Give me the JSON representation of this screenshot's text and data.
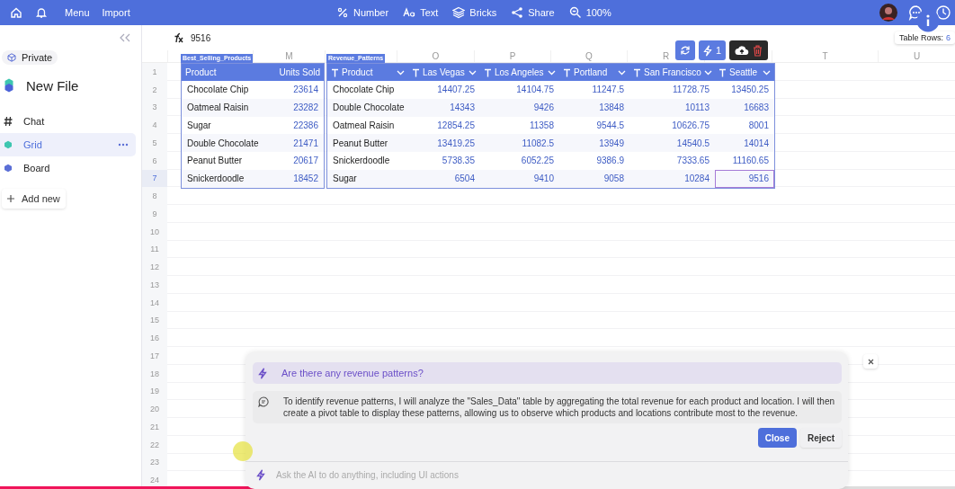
{
  "topbar": {
    "menu_items": [
      "Menu",
      "Import"
    ],
    "tools": [
      {
        "kind": "percent",
        "label": "Number"
      },
      {
        "kind": "text",
        "label": "Text"
      },
      {
        "kind": "layers",
        "label": "Bricks"
      },
      {
        "kind": "share",
        "label": "Share"
      },
      {
        "kind": "zoom",
        "label": "100%"
      }
    ]
  },
  "sidebar": {
    "workspace": "Private",
    "file_name": "New File",
    "items": [
      {
        "kind": "chat",
        "label": "Chat",
        "selected": false
      },
      {
        "kind": "grid",
        "label": "Grid",
        "selected": true
      },
      {
        "kind": "board",
        "label": "Board",
        "selected": false
      }
    ],
    "add_new": "Add new"
  },
  "formula": "9516",
  "table_rows_info": {
    "label": "Table Rows:",
    "value": "6"
  },
  "column_letters": [
    "M",
    "O",
    "P",
    "Q",
    "R",
    "T",
    "U"
  ],
  "row_numbers": [
    {
      "label": "1",
      "selected": false
    },
    {
      "label": "2",
      "selected": false
    },
    {
      "label": "3",
      "selected": false
    },
    {
      "label": "4",
      "selected": false
    },
    {
      "label": "5",
      "selected": false
    },
    {
      "label": "6",
      "selected": false
    },
    {
      "label": "7",
      "selected": true
    },
    {
      "label": "8",
      "selected": false
    },
    {
      "label": "9",
      "selected": false
    },
    {
      "label": "10",
      "selected": false
    },
    {
      "label": "11",
      "selected": false
    },
    {
      "label": "12",
      "selected": false
    },
    {
      "label": "13",
      "selected": false
    },
    {
      "label": "14",
      "selected": false
    },
    {
      "label": "15",
      "selected": false
    },
    {
      "label": "16",
      "selected": false
    },
    {
      "label": "17",
      "selected": false
    },
    {
      "label": "18",
      "selected": false
    },
    {
      "label": "19",
      "selected": false
    },
    {
      "label": "20",
      "selected": false
    },
    {
      "label": "21",
      "selected": false
    },
    {
      "label": "22",
      "selected": false
    },
    {
      "label": "23",
      "selected": false
    },
    {
      "label": "24",
      "selected": false
    }
  ],
  "table_toolbar": {
    "count": "1"
  },
  "tables": [
    {
      "name": "Best_Selling_Products",
      "kind": "plain",
      "columns": [
        {
          "label": "Product",
          "kind": "text"
        },
        {
          "label": "Units Sold",
          "kind": "number"
        }
      ],
      "rows": [
        {
          "cells": [
            {
              "text": "Chocolate Chip",
              "selected": false
            },
            {
              "text": "23614",
              "selected": false
            }
          ]
        },
        {
          "cells": [
            {
              "text": "Oatmeal Raisin",
              "selected": false
            },
            {
              "text": "23282",
              "selected": false
            }
          ]
        },
        {
          "cells": [
            {
              "text": "Sugar",
              "selected": false
            },
            {
              "text": "22386",
              "selected": false
            }
          ]
        },
        {
          "cells": [
            {
              "text": "Double Chocolate",
              "selected": false
            },
            {
              "text": "21471",
              "selected": false
            }
          ]
        },
        {
          "cells": [
            {
              "text": "Peanut Butter",
              "selected": false
            },
            {
              "text": "20617",
              "selected": false
            }
          ]
        },
        {
          "cells": [
            {
              "text": "Snickerdoodle",
              "selected": false
            },
            {
              "text": "18452",
              "selected": false
            }
          ]
        }
      ]
    },
    {
      "name": "Revenue_Patterns",
      "kind": "typed",
      "columns": [
        {
          "label": "Product",
          "kind": "text"
        },
        {
          "label": "Las Vegas",
          "kind": "number"
        },
        {
          "label": "Los Angeles",
          "kind": "number"
        },
        {
          "label": "Portland",
          "kind": "number"
        },
        {
          "label": "San Francisco",
          "kind": "number"
        },
        {
          "label": "Seattle",
          "kind": "number"
        }
      ],
      "rows": [
        {
          "cells": [
            {
              "text": "Chocolate Chip",
              "selected": false
            },
            {
              "text": "14407.25",
              "selected": false
            },
            {
              "text": "14104.75",
              "selected": false
            },
            {
              "text": "11247.5",
              "selected": false
            },
            {
              "text": "11728.75",
              "selected": false
            },
            {
              "text": "13450.25",
              "selected": false
            }
          ]
        },
        {
          "cells": [
            {
              "text": "Double Chocolate",
              "selected": false
            },
            {
              "text": "14343",
              "selected": false
            },
            {
              "text": "9426",
              "selected": false
            },
            {
              "text": "13848",
              "selected": false
            },
            {
              "text": "10113",
              "selected": false
            },
            {
              "text": "16683",
              "selected": false
            }
          ]
        },
        {
          "cells": [
            {
              "text": "Oatmeal Raisin",
              "selected": false
            },
            {
              "text": "12854.25",
              "selected": false
            },
            {
              "text": "11358",
              "selected": false
            },
            {
              "text": "9544.5",
              "selected": false
            },
            {
              "text": "10626.75",
              "selected": false
            },
            {
              "text": "8001",
              "selected": false
            }
          ]
        },
        {
          "cells": [
            {
              "text": "Peanut Butter",
              "selected": false
            },
            {
              "text": "13419.25",
              "selected": false
            },
            {
              "text": "11082.5",
              "selected": false
            },
            {
              "text": "13949",
              "selected": false
            },
            {
              "text": "14540.5",
              "selected": false
            },
            {
              "text": "14014",
              "selected": false
            }
          ]
        },
        {
          "cells": [
            {
              "text": "Snickerdoodle",
              "selected": false
            },
            {
              "text": "5738.35",
              "selected": false
            },
            {
              "text": "6052.25",
              "selected": false
            },
            {
              "text": "9386.9",
              "selected": false
            },
            {
              "text": "7333.65",
              "selected": false
            },
            {
              "text": "11160.65",
              "selected": false
            }
          ]
        },
        {
          "cells": [
            {
              "text": "Sugar",
              "selected": false
            },
            {
              "text": "6504",
              "selected": false
            },
            {
              "text": "9410",
              "selected": false
            },
            {
              "text": "9058",
              "selected": false
            },
            {
              "text": "10284",
              "selected": false
            },
            {
              "text": "9516",
              "selected": true
            }
          ]
        }
      ]
    }
  ],
  "chat": {
    "question": "Are there any revenue patterns?",
    "answer": "To identify revenue patterns, I will analyze the \"Sales_Data\" table by aggregating the total revenue for each product and location. I will then create a pivot table to display these patterns, allowing us to observe which products and locations contribute most to the revenue.",
    "buttons": [
      {
        "label": "Close",
        "kind": "primary"
      },
      {
        "label": "Reject",
        "kind": "secondary"
      }
    ],
    "placeholder": "Ask the AI to do anything, including UI actions"
  },
  "video_progress": {
    "level": 0.68
  }
}
